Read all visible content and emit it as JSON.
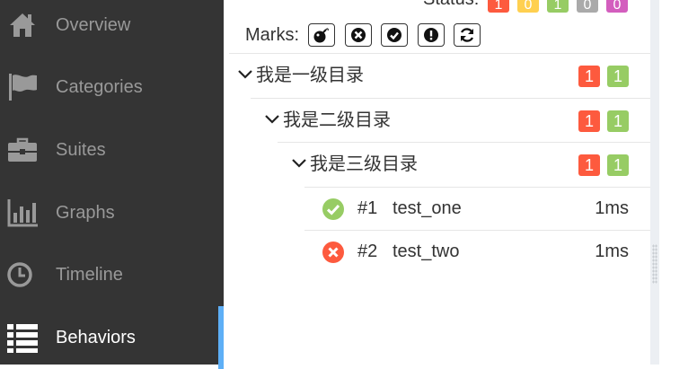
{
  "sidebar": {
    "items": [
      {
        "label": "Overview",
        "icon": "home-icon"
      },
      {
        "label": "Categories",
        "icon": "flag-icon"
      },
      {
        "label": "Suites",
        "icon": "briefcase-icon"
      },
      {
        "label": "Graphs",
        "icon": "bar-chart-icon"
      },
      {
        "label": "Timeline",
        "icon": "clock-icon"
      },
      {
        "label": "Behaviors",
        "icon": "list-icon",
        "active": true
      }
    ]
  },
  "status": {
    "label": "Status:",
    "counts": [
      "1",
      "0",
      "1",
      "0",
      "0"
    ],
    "colors": [
      "#fd5a3e",
      "#ffd050",
      "#97cc64",
      "#aaaaaa",
      "#d35ebe"
    ]
  },
  "marks": {
    "label": "Marks:",
    "buttons": [
      "bomb-icon",
      "close-circle-icon",
      "check-circle-icon",
      "exclamation-icon",
      "refresh-icon"
    ]
  },
  "tree": {
    "level1": {
      "name": "我是一级目录",
      "failed": "1",
      "passed": "1"
    },
    "level2": {
      "name": "我是二级目录",
      "failed": "1",
      "passed": "1"
    },
    "level3": {
      "name": "我是三级目录",
      "failed": "1",
      "passed": "1"
    },
    "tests": [
      {
        "num": "#1",
        "name": "test_one",
        "duration": "1ms",
        "status": "passed"
      },
      {
        "num": "#2",
        "name": "test_two",
        "duration": "1ms",
        "status": "failed"
      }
    ]
  }
}
